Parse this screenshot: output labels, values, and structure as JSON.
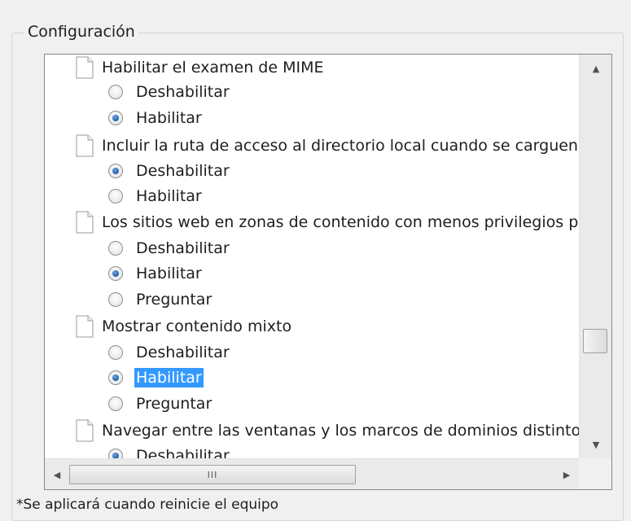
{
  "group_title": "Configuración",
  "items": [
    {
      "type": "setting",
      "label": "Habilitar el examen de MIME"
    },
    {
      "type": "option",
      "label": "Deshabilitar",
      "checked": false
    },
    {
      "type": "option",
      "label": "Habilitar",
      "checked": true
    },
    {
      "type": "setting",
      "label": "Incluir la ruta de acceso al directorio local cuando se carguen"
    },
    {
      "type": "option",
      "label": "Deshabilitar",
      "checked": true
    },
    {
      "type": "option",
      "label": "Habilitar",
      "checked": false
    },
    {
      "type": "setting",
      "label": "Los sitios web en zonas de contenido con menos privilegios p"
    },
    {
      "type": "option",
      "label": "Deshabilitar",
      "checked": false
    },
    {
      "type": "option",
      "label": "Habilitar",
      "checked": true
    },
    {
      "type": "option",
      "label": "Preguntar",
      "checked": false
    },
    {
      "type": "setting",
      "label": "Mostrar contenido mixto"
    },
    {
      "type": "option",
      "label": "Deshabilitar",
      "checked": false
    },
    {
      "type": "option",
      "label": "Habilitar",
      "checked": true,
      "selected": true
    },
    {
      "type": "option",
      "label": "Preguntar",
      "checked": false
    },
    {
      "type": "setting",
      "label": "Navegar entre las ventanas y los marcos de dominios distinto"
    },
    {
      "type": "option",
      "label": "Deshabilitar",
      "checked": true
    }
  ],
  "scroll": {
    "up_arrow": "▲",
    "down_arrow": "▼",
    "left_arrow": "◀",
    "right_arrow": "▶",
    "h_thumb_grip": "III"
  },
  "footnote": "*Se aplicará cuando reinicie el equipo"
}
